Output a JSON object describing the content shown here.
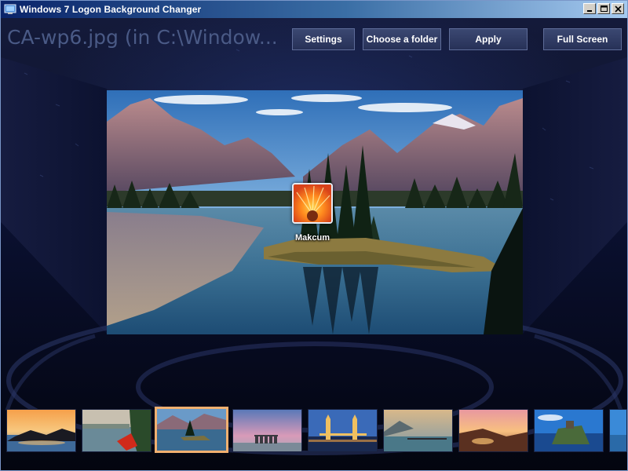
{
  "window": {
    "title": "Windows 7 Logon Background Changer",
    "controls": [
      "minimize",
      "maximize",
      "close"
    ]
  },
  "toolbar": {
    "file_title": "CA-wp6.jpg (in C:\\Window...",
    "settings_label": "Settings",
    "choose_folder_label": "Choose a folder",
    "apply_label": "Apply",
    "fullscreen_label": "Full Screen"
  },
  "preview": {
    "username": "Makcum",
    "scene": "mountain-lake-island"
  },
  "thumbnails": {
    "selected_index": 2,
    "items": [
      "sunset-coast",
      "red-kayak-lake",
      "mountain-lake-island",
      "stonehenge",
      "tower-bridge",
      "misty-lake-pier",
      "sunset-rocky-shore",
      "coastal-cliff-castle",
      "blue-sea-partial"
    ]
  },
  "colors": {
    "accent_selected": "#f0b070",
    "button_bg": "#303c66",
    "title_bar": "#0a246a"
  }
}
